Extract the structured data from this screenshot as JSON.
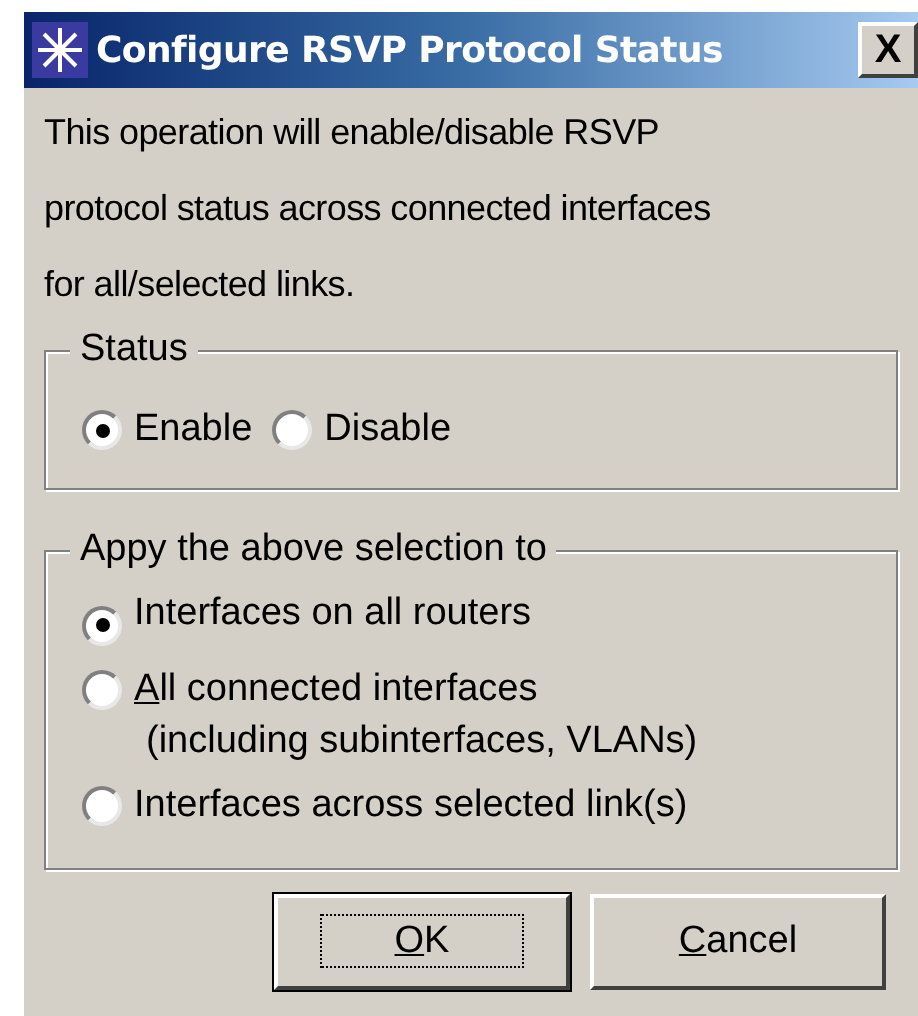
{
  "window": {
    "title": "Configure RSVP Protocol Status",
    "close": "X"
  },
  "description": [
    "This operation will enable/disable RSVP",
    "protocol status across connected interfaces",
    "for all/selected links."
  ],
  "status_group": {
    "title": "Status",
    "options": [
      {
        "label": "Enable",
        "selected": true
      },
      {
        "label": "Disable",
        "selected": false
      }
    ]
  },
  "apply_group": {
    "title": "Appy the above selection to",
    "options": [
      {
        "label": "Interfaces on all routers",
        "selected": true
      },
      {
        "accel": "A",
        "label": "ll connected interfaces",
        "sublabel": "(including subinterfaces, VLANs)",
        "selected": false
      },
      {
        "label": "Interfaces across selected link(s)",
        "selected": false
      }
    ]
  },
  "buttons": [
    {
      "accel": "O",
      "label": "K",
      "default": true
    },
    {
      "accel": "C",
      "label": "ancel",
      "default": false
    }
  ]
}
